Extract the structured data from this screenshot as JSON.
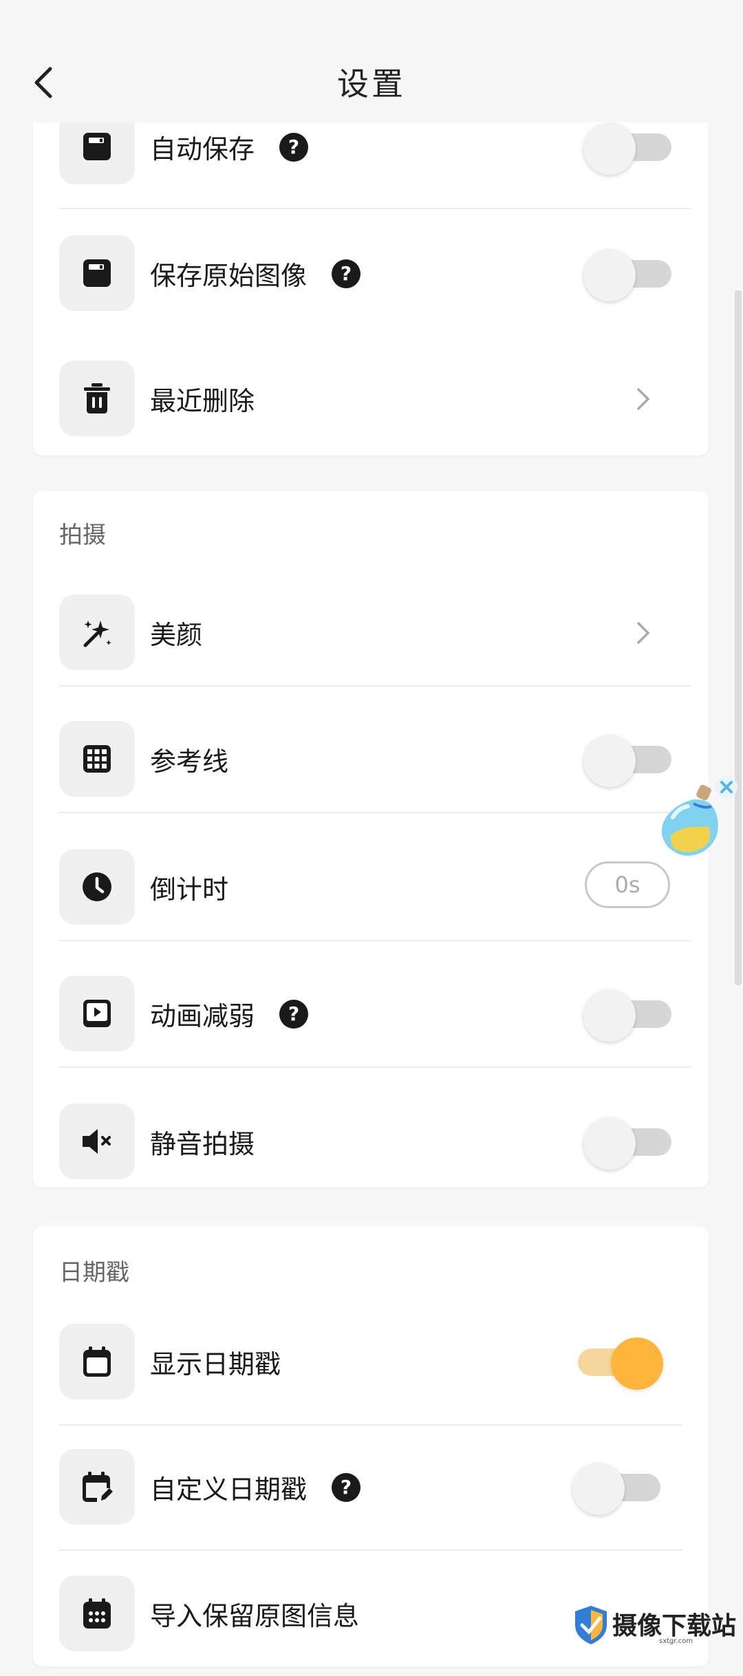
{
  "header": {
    "title": "设置"
  },
  "storage": {
    "rows": [
      {
        "label": "自动保存",
        "help": "?",
        "toggle_on": false
      },
      {
        "label": "保存原始图像",
        "help": "?",
        "toggle_on": false
      },
      {
        "label": "最近删除"
      }
    ]
  },
  "shooting": {
    "title": "拍摄",
    "rows": [
      {
        "label": "美颜"
      },
      {
        "label": "参考线",
        "toggle_on": false
      },
      {
        "label": "倒计时",
        "value": "0s"
      },
      {
        "label": "动画减弱",
        "help": "?",
        "toggle_on": false
      },
      {
        "label": "静音拍摄",
        "toggle_on": false
      }
    ]
  },
  "datestamp": {
    "title": "日期戳",
    "rows": [
      {
        "label": "显示日期戳",
        "toggle_on": true
      },
      {
        "label": "自定义日期戳",
        "help": "?",
        "toggle_on": false
      },
      {
        "label": "导入保留原图信息"
      }
    ]
  },
  "watermark": {
    "text": "摄像下载站",
    "url": "sxtgr.com"
  },
  "colors": {
    "accent": "#ffb43a",
    "accent_track": "#f4d79b",
    "background": "#f7f7f7"
  }
}
